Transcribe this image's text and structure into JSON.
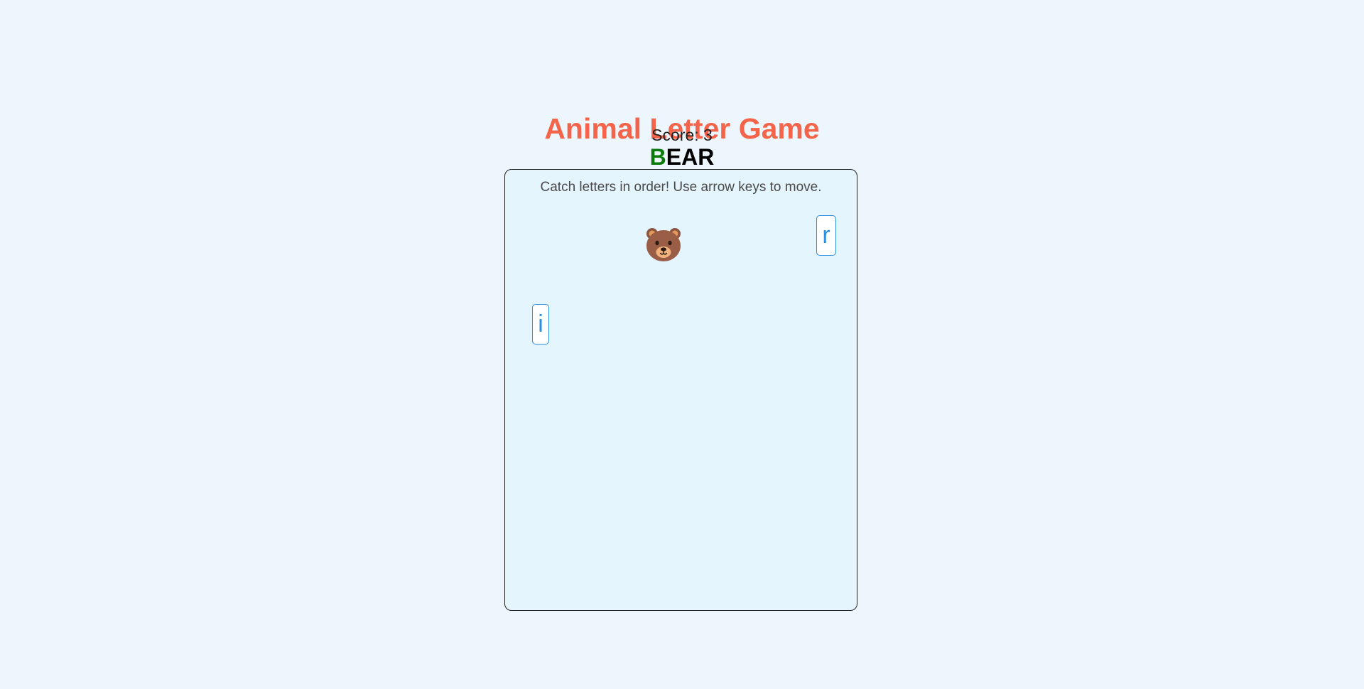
{
  "game": {
    "title": "Animal Letter Game",
    "score_text": "Score: 3",
    "word": {
      "caught": "B",
      "remaining": "EAR"
    },
    "instructions": "Catch letters in order! Use arrow keys to move.",
    "player_icon": "bear-face-icon",
    "falling_letters": [
      {
        "letter": "r"
      },
      {
        "letter": "i"
      }
    ]
  },
  "colors": {
    "background": "#eef6fd",
    "title": "#f4644a",
    "caught_letter": "#0b7a0b",
    "board_background": "#e5f5fd",
    "tile_accent": "#2b8ee0"
  }
}
